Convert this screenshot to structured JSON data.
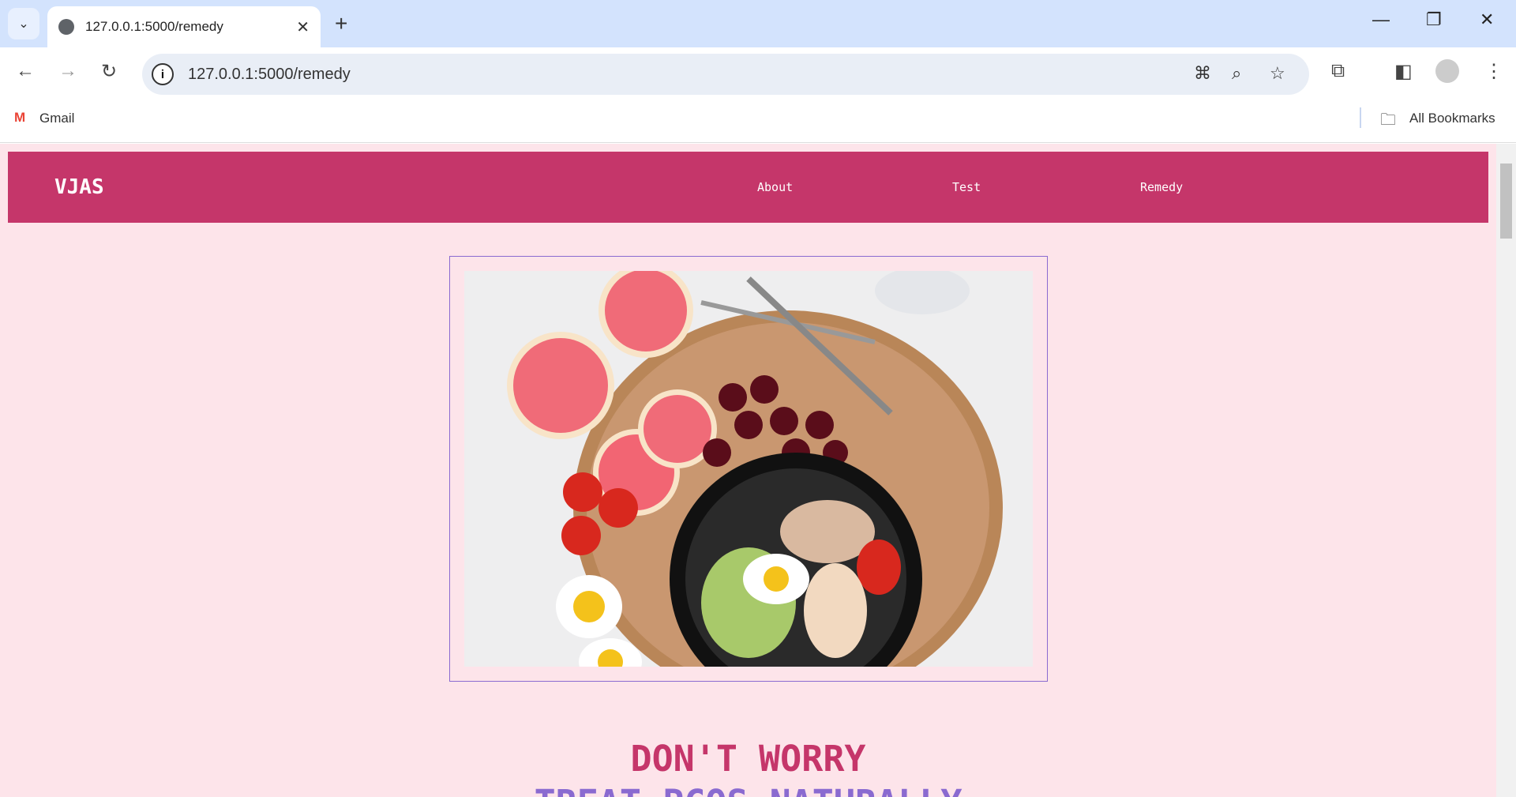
{
  "browser": {
    "tab_title": "127.0.0.1:5000/remedy",
    "url": "127.0.0.1:5000/remedy",
    "bookmarks": [
      {
        "label": "Gmail"
      }
    ],
    "all_bookmarks": "All Bookmarks"
  },
  "site": {
    "brand": "VJAS",
    "nav": [
      {
        "label": "About"
      },
      {
        "label": "Test"
      },
      {
        "label": "Remedy"
      }
    ],
    "heading": "DON'T WORRY",
    "subheading": "TREAT PCOS NATURALLY",
    "colors": {
      "primary": "#c5366a",
      "accent": "#8a6ad0",
      "background": "#fde4ea"
    }
  }
}
